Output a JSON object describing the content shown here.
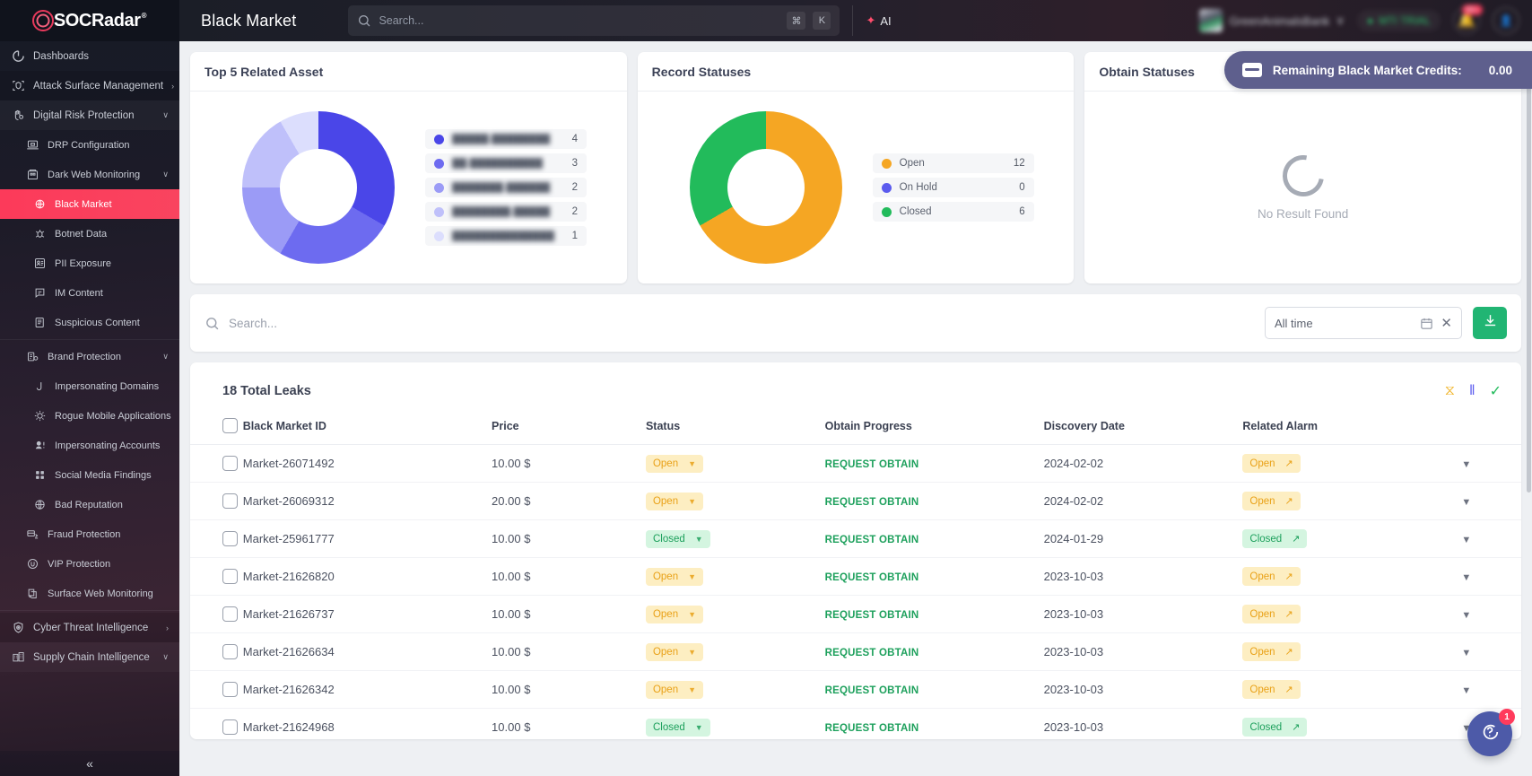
{
  "brand": {
    "name": "SOCRadar",
    "registered": "®"
  },
  "header": {
    "page_title": "Black Market",
    "search_placeholder": "Search...",
    "kbd_cmd": "⌘",
    "kbd_k": "K",
    "ai_label": "AI",
    "org_name": "GreenAnimalsBank",
    "org_caret": "∨",
    "trial_label": "MTI TRIAL",
    "notification_count": "99+",
    "accent_red": "#fc3a5a"
  },
  "sidebar": {
    "items": [
      {
        "label": "Dashboards",
        "icon": "dashboard-icon",
        "level": "top",
        "chevron": "",
        "state": ""
      },
      {
        "label": "Attack Surface Management",
        "icon": "shield-scan-icon",
        "level": "group",
        "chevron": "›",
        "state": "dim"
      },
      {
        "label": "Digital Risk Protection",
        "icon": "hand-shield-icon",
        "level": "group",
        "chevron": "∨",
        "state": ""
      },
      {
        "label": "DRP Configuration",
        "icon": "laptop-icon",
        "level": "sub",
        "chevron": "",
        "state": ""
      },
      {
        "label": "Dark Web Monitoring",
        "icon": "darkweb-icon",
        "level": "sub",
        "chevron": "∨",
        "state": ""
      },
      {
        "label": "Black Market",
        "icon": "black-market-icon",
        "level": "sub2",
        "chevron": "",
        "state": "active"
      },
      {
        "label": "Botnet Data",
        "icon": "botnet-icon",
        "level": "sub2",
        "chevron": "",
        "state": ""
      },
      {
        "label": "PII Exposure",
        "icon": "pii-icon",
        "level": "sub2",
        "chevron": "",
        "state": ""
      },
      {
        "label": "IM Content",
        "icon": "im-content-icon",
        "level": "sub2",
        "chevron": "",
        "state": ""
      },
      {
        "label": "Suspicious Content",
        "icon": "suspicious-icon",
        "level": "sub2",
        "chevron": "",
        "state": ""
      },
      {
        "label": "Brand Protection",
        "icon": "brand-icon",
        "level": "sub",
        "chevron": "∨",
        "state": ""
      },
      {
        "label": "Impersonating Domains",
        "icon": "domain-icon",
        "level": "sub2",
        "chevron": "",
        "state": ""
      },
      {
        "label": "Rogue Mobile Applications",
        "icon": "rogue-app-icon",
        "level": "sub2",
        "chevron": "",
        "state": ""
      },
      {
        "label": "Impersonating Accounts",
        "icon": "account-icon",
        "level": "sub2",
        "chevron": "",
        "state": ""
      },
      {
        "label": "Social Media Findings",
        "icon": "grid-icon",
        "level": "sub2",
        "chevron": "",
        "state": ""
      },
      {
        "label": "Bad Reputation",
        "icon": "globe-icon",
        "level": "sub2",
        "chevron": "",
        "state": ""
      },
      {
        "label": "Fraud Protection",
        "icon": "fraud-icon",
        "level": "sub",
        "chevron": "",
        "state": ""
      },
      {
        "label": "VIP Protection",
        "icon": "vip-icon",
        "level": "sub",
        "chevron": "",
        "state": ""
      },
      {
        "label": "Surface Web Monitoring",
        "icon": "surface-web-icon",
        "level": "sub",
        "chevron": "",
        "state": ""
      },
      {
        "label": "Cyber Threat Intelligence",
        "icon": "cti-eye-icon",
        "level": "group",
        "chevron": "›",
        "state": "dim"
      },
      {
        "label": "Supply Chain Intelligence",
        "icon": "supply-chain-icon",
        "level": "group",
        "chevron": "∨",
        "state": ""
      }
    ],
    "collapse_glyph": "«"
  },
  "credits_banner": {
    "label": "Remaining Black Market Credits:",
    "value": "0.00",
    "bg": "#5e5f8d"
  },
  "cards": {
    "top_assets": {
      "title": "Top 5 Related Asset"
    },
    "record_statuses": {
      "title": "Record Statuses"
    },
    "obtain_statuses": {
      "title": "Obtain Statuses",
      "empty_text": "No Result Found"
    }
  },
  "chart_data": [
    {
      "type": "pie",
      "title": "Top 5 Related Asset",
      "legend_position": "right",
      "labels_redacted": true,
      "categories": [
        "█████.████████",
        "██.██████████",
        "███████.██████",
        "████████.█████",
        "██████████████"
      ],
      "values": [
        4,
        3,
        2,
        2,
        1
      ],
      "colors": [
        "#4a46e8",
        "#6d6bf0",
        "#9b9bf6",
        "#bfc0fa",
        "#dcdefd"
      ]
    },
    {
      "type": "pie",
      "title": "Record Statuses",
      "legend_position": "right",
      "categories": [
        "Open",
        "On Hold",
        "Closed"
      ],
      "values": [
        12,
        0,
        6
      ],
      "colors": [
        "#f5a623",
        "#5b5bee",
        "#22bb5b"
      ]
    },
    {
      "type": "pie",
      "title": "Obtain Statuses",
      "categories": [],
      "values": [],
      "empty": true,
      "empty_text": "No Result Found"
    }
  ],
  "filter_bar": {
    "search_placeholder": "Search...",
    "date_value": "All time",
    "calendar_icon": "calendar-icon",
    "clear_glyph": "✕",
    "download_icon": "download-icon",
    "download_bg": "#21b573"
  },
  "table": {
    "total_label": "18 Total Leaks",
    "toolbar_icons": [
      {
        "name": "hourglass-icon",
        "glyph": "⧖",
        "color": "#f0b429"
      },
      {
        "name": "pause-icon",
        "glyph": "‖",
        "color": "#5b5bee"
      },
      {
        "name": "check-icon",
        "glyph": "✓",
        "color": "#22bb5b"
      }
    ],
    "columns": [
      "Black Market ID",
      "Price",
      "Status",
      "Obtain Progress",
      "Discovery Date",
      "Related Alarm"
    ],
    "obtain_action_label": "REQUEST OBTAIN",
    "rows": [
      {
        "id": "Market-26071492",
        "price": "10.00 $",
        "status": "Open",
        "obtain": "REQUEST OBTAIN",
        "date": "2024-02-02",
        "alarm": "Open"
      },
      {
        "id": "Market-26069312",
        "price": "20.00 $",
        "status": "Open",
        "obtain": "REQUEST OBTAIN",
        "date": "2024-02-02",
        "alarm": "Open"
      },
      {
        "id": "Market-25961777",
        "price": "10.00 $",
        "status": "Closed",
        "obtain": "REQUEST OBTAIN",
        "date": "2024-01-29",
        "alarm": "Closed"
      },
      {
        "id": "Market-21626820",
        "price": "10.00 $",
        "status": "Open",
        "obtain": "REQUEST OBTAIN",
        "date": "2023-10-03",
        "alarm": "Open"
      },
      {
        "id": "Market-21626737",
        "price": "10.00 $",
        "status": "Open",
        "obtain": "REQUEST OBTAIN",
        "date": "2023-10-03",
        "alarm": "Open"
      },
      {
        "id": "Market-21626634",
        "price": "10.00 $",
        "status": "Open",
        "obtain": "REQUEST OBTAIN",
        "date": "2023-10-03",
        "alarm": "Open"
      },
      {
        "id": "Market-21626342",
        "price": "10.00 $",
        "status": "Open",
        "obtain": "REQUEST OBTAIN",
        "date": "2023-10-03",
        "alarm": "Open"
      },
      {
        "id": "Market-21624968",
        "price": "10.00 $",
        "status": "Closed",
        "obtain": "REQUEST OBTAIN",
        "date": "2023-10-03",
        "alarm": "Closed"
      }
    ]
  },
  "chat": {
    "badge": "1",
    "icon": "chat-help-icon"
  }
}
